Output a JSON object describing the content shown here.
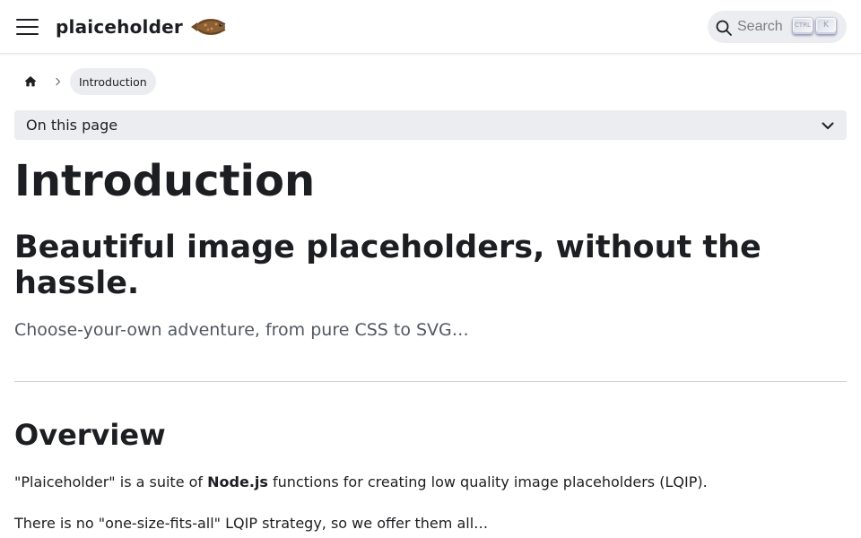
{
  "navbar": {
    "brand_title": "plaiceholder",
    "logo_icon": "plaice-fish-logo",
    "menu_icon": "hamburger-menu-icon",
    "search": {
      "label": "Search",
      "shortcut_ctrl": "CTRL",
      "shortcut_key": "K"
    }
  },
  "breadcrumbs": {
    "home_icon": "home-icon",
    "separator_icon": "chevron-right-icon",
    "current": "Introduction"
  },
  "toc": {
    "label": "On this page",
    "chevron_icon": "chevron-down-icon"
  },
  "content": {
    "title": "Introduction",
    "hero_heading": "Beautiful image placeholders, without the hassle.",
    "hero_subtitle": "Choose-your-own adventure, from pure CSS to SVG…",
    "overview_heading": "Overview",
    "paragraph_1": {
      "before": "\"Plaiceholder\" is a suite of ",
      "bold": "Node.js",
      "after": " functions for creating low quality image placeholders (LQIP)."
    },
    "paragraph_2": "There is no \"one-size-fits-all\" LQIP strategy, so we offer them all…"
  },
  "colors": {
    "text": "#1c1e21",
    "muted_text": "#525860",
    "pill_background": "#ebedf0",
    "divider": "#d0d0d0"
  }
}
